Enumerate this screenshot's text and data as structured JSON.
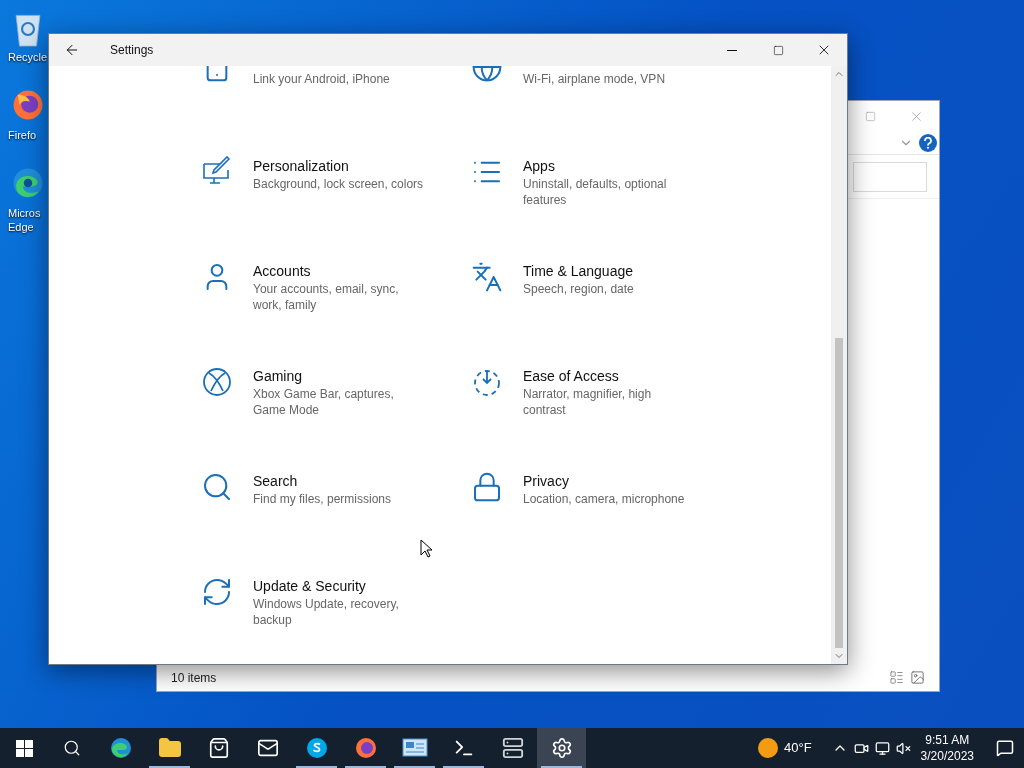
{
  "desktop_icons": [
    {
      "kind": "recycle-bin",
      "label_lines": [
        "Recycle"
      ]
    },
    {
      "kind": "firefox",
      "label_lines": [
        "Firefo"
      ]
    },
    {
      "kind": "edge",
      "label_lines": [
        "Micros",
        "Edge"
      ]
    }
  ],
  "back_window": {
    "status": "10 items"
  },
  "settings": {
    "title": "Settings",
    "items": [
      {
        "kind": "phone",
        "description": "Link your Android, iPhone"
      },
      {
        "kind": "network",
        "description": "Wi-Fi, airplane mode, VPN"
      },
      {
        "kind": "personalization",
        "title": "Personalization",
        "description": "Background, lock screen, colors"
      },
      {
        "kind": "apps",
        "title": "Apps",
        "description": "Uninstall, defaults, optional features"
      },
      {
        "kind": "accounts",
        "title": "Accounts",
        "description": "Your accounts, email, sync, work, family"
      },
      {
        "kind": "time",
        "title": "Time & Language",
        "description": "Speech, region, date"
      },
      {
        "kind": "gaming",
        "title": "Gaming",
        "description": "Xbox Game Bar, captures, Game Mode"
      },
      {
        "kind": "ease",
        "title": "Ease of Access",
        "description": "Narrator, magnifier, high contrast"
      },
      {
        "kind": "search",
        "title": "Search",
        "description": "Find my files, permissions"
      },
      {
        "kind": "privacy",
        "title": "Privacy",
        "description": "Location, camera, microphone"
      },
      {
        "kind": "update",
        "title": "Update & Security",
        "description": "Windows Update, recovery, backup"
      }
    ]
  },
  "taskbar": {
    "apps": [
      {
        "kind": "edge",
        "running": false,
        "selected": false
      },
      {
        "kind": "explorer",
        "running": true,
        "selected": false
      },
      {
        "kind": "store",
        "running": false,
        "selected": false
      },
      {
        "kind": "mail",
        "running": false,
        "selected": false
      },
      {
        "kind": "skype",
        "running": true,
        "selected": false
      },
      {
        "kind": "firefox",
        "running": true,
        "selected": false
      },
      {
        "kind": "control-panel",
        "running": true,
        "selected": false
      },
      {
        "kind": "terminal",
        "running": true,
        "selected": false
      },
      {
        "kind": "server",
        "running": false,
        "selected": false
      },
      {
        "kind": "settings",
        "running": true,
        "selected": true
      }
    ],
    "weather": "40°F",
    "time": "9:51 AM",
    "date": "3/20/2023"
  }
}
